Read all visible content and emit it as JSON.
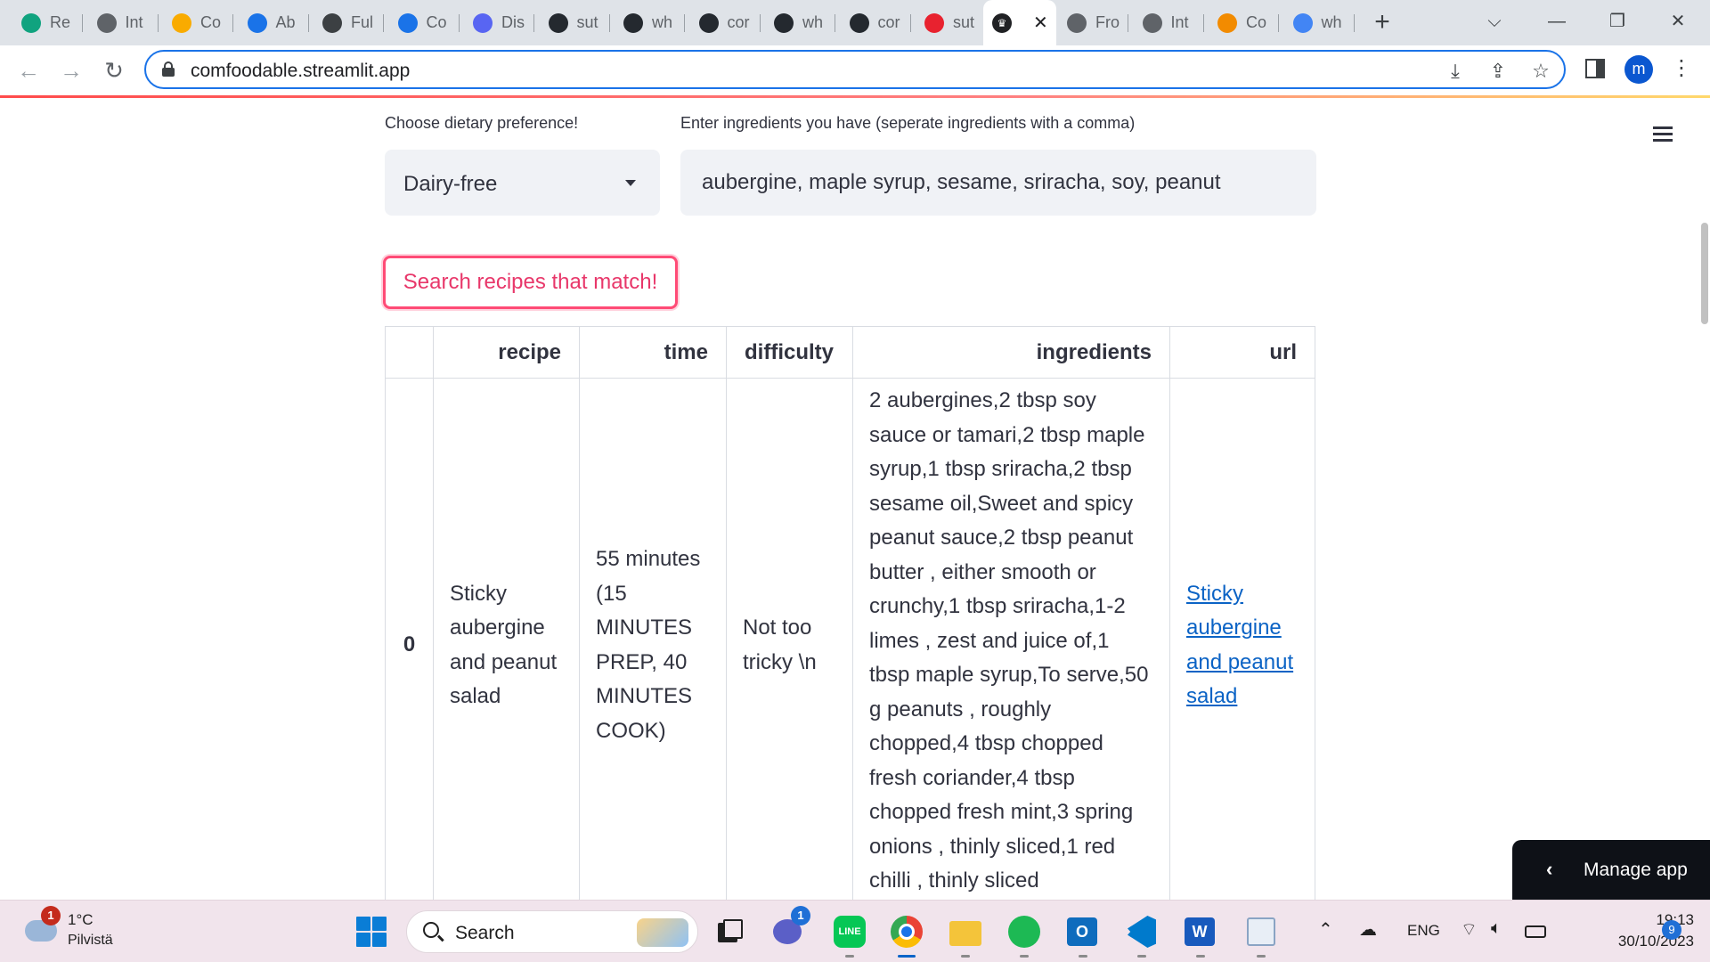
{
  "browser": {
    "tabs": [
      {
        "title": "Re",
        "icon": "chatgpt-icon",
        "color": "#10a37f"
      },
      {
        "title": "Int",
        "icon": "globe-icon",
        "color": "#5f6368"
      },
      {
        "title": "Co",
        "icon": "colab-icon",
        "color": "#f9ab00"
      },
      {
        "title": "Ab",
        "icon": "shield-icon",
        "color": "#1a73e8"
      },
      {
        "title": "Ful",
        "icon": "window-icon",
        "color": "#3c4043"
      },
      {
        "title": "Co",
        "icon": "shield-icon",
        "color": "#1a73e8"
      },
      {
        "title": "Dis",
        "icon": "discord-icon",
        "color": "#5865f2"
      },
      {
        "title": "sut",
        "icon": "github-icon",
        "color": "#24292f"
      },
      {
        "title": "wh",
        "icon": "github-icon",
        "color": "#24292f"
      },
      {
        "title": "cor",
        "icon": "github-icon",
        "color": "#24292f"
      },
      {
        "title": "wh",
        "icon": "github-icon",
        "color": "#24292f"
      },
      {
        "title": "cor",
        "icon": "github-icon",
        "color": "#24292f"
      },
      {
        "title": "sut",
        "icon": "streamlit-icon",
        "color": "#e8222f"
      }
    ],
    "active_tab": {
      "icon": "streamlit-crown-icon",
      "close": "✕"
    },
    "tabs_after": [
      {
        "title": "Fro",
        "icon": "globe-icon",
        "color": "#5f6368"
      },
      {
        "title": "Int",
        "icon": "globe-icon",
        "color": "#5f6368"
      },
      {
        "title": "Co",
        "icon": "marktechpost-icon",
        "color": "#f28b00"
      },
      {
        "title": "wh",
        "icon": "google-icon",
        "color": "#4285f4"
      }
    ],
    "url": "comfoodable.streamlit.app",
    "profile_initial": "m"
  },
  "app": {
    "diet_label": "Choose dietary preference!",
    "diet_value": "Dairy-free",
    "ingredients_label": "Enter ingredients you have (seperate ingredients with a comma)",
    "ingredients_value": "aubergine, maple syrup, sesame, sriracha, soy, peanut",
    "search_button": "Search recipes that match!",
    "table": {
      "columns": [
        "",
        "recipe",
        "time",
        "difficulty",
        "ingredients",
        "url"
      ],
      "rows": [
        {
          "index": "0",
          "recipe": "Sticky aubergine and peanut salad",
          "time": "55 minutes (15 MINUTES PREP, 40 MINUTES COOK)",
          "difficulty": "Not too tricky \\n",
          "ingredients": "2 aubergines,2 tbsp soy sauce or tamari,2 tbsp maple syrup,1 tbsp sriracha,2 tbsp sesame oil,Sweet and spicy peanut sauce,2 tbsp peanut butter , either smooth or crunchy,1 tbsp sriracha,1-2 limes , zest and juice of,1 tbsp maple syrup,To serve,50 g peanuts , roughly chopped,4 tbsp chopped fresh coriander,4 tbsp chopped fresh mint,3 spring onions , thinly sliced,1 red chilli , thinly sliced",
          "url_text": "Sticky aubergine and peanut salad"
        }
      ]
    },
    "manage_app": "Manage app"
  },
  "taskbar": {
    "weather_temp": "1°C",
    "weather_desc": "Pilvistä",
    "weather_badge": "1",
    "search_placeholder": "Search",
    "teams_badge": "1",
    "language": "ENG",
    "time": "19:13",
    "date": "30/10/2023",
    "notification_count": "9"
  }
}
